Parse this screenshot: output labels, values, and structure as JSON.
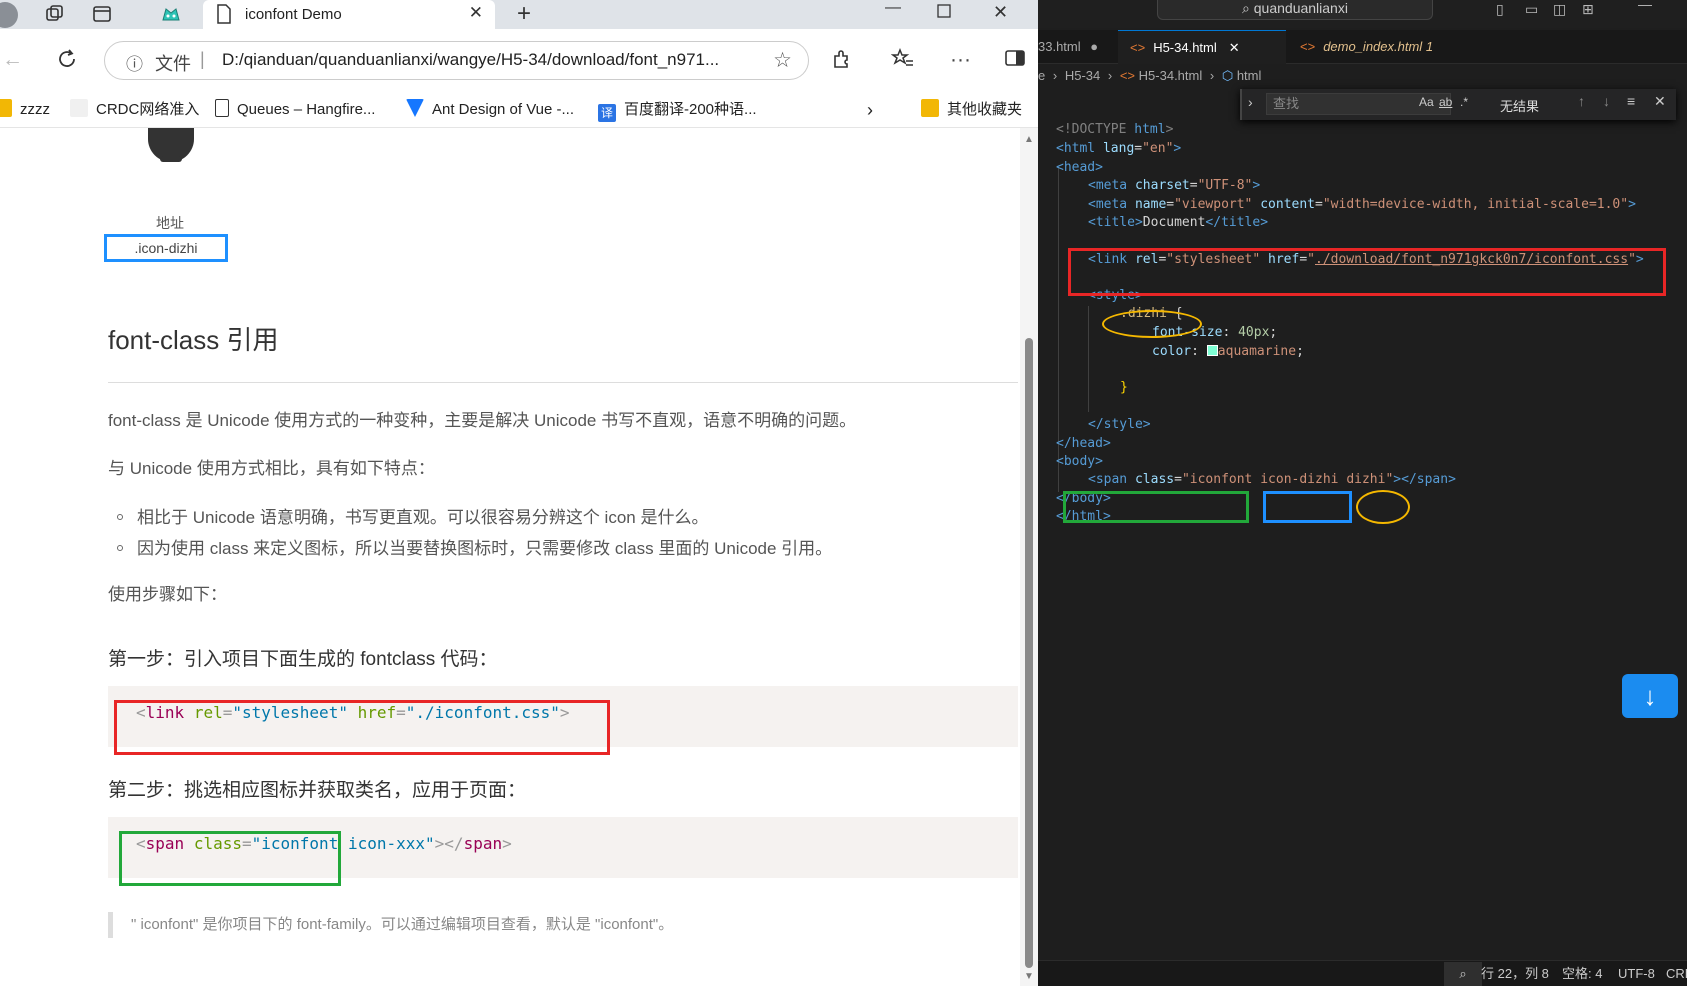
{
  "browser": {
    "tab_title": "iconfont Demo",
    "address": {
      "scheme_label": "文件",
      "url": "D:/qianduan/quanduanlianxi/wangye/H5-34/download/font_n971..."
    },
    "bookmarks": [
      {
        "label": "zzzz",
        "color": "#f2b705"
      },
      {
        "label": "CRDC网络准入",
        "color": "#ffffff"
      },
      {
        "label": "Queues – Hangfire...",
        "color": "#ffffff"
      },
      {
        "label": "Ant Design of Vue -...",
        "color": "#1677ff"
      },
      {
        "label": "百度翻译-200种语...",
        "color": "#2b74e4"
      },
      {
        "label": "其他收藏夹",
        "color": "#f2b705"
      }
    ]
  },
  "page": {
    "icon_name": "地址",
    "icon_class": ".icon-dizhi",
    "heading": "font-class 引用",
    "para1": "font-class 是 Unicode 使用方式的一种变种，主要是解决 Unicode 书写不直观，语意不明确的问题。",
    "para2": "与 Unicode 使用方式相比，具有如下特点：",
    "list": [
      "相比于 Unicode 语意明确，书写更直观。可以很容易分辨这个 icon 是什么。",
      "因为使用 class 来定义图标，所以当要替换图标时，只需要修改 class 里面的 Unicode 引用。"
    ],
    "para3": "使用步骤如下：",
    "step1": "第一步：引入项目下面生成的 fontclass 代码：",
    "code1": {
      "lt": "<",
      "tag": "link",
      "sp1": " ",
      "attr1": "rel",
      "eq1": "=",
      "val1": "\"stylesheet\"",
      "sp2": " ",
      "attr2": "href",
      "eq2": "=",
      "val2": "\"./iconfont.css\"",
      "gt": ">"
    },
    "step2": "第二步：挑选相应图标并获取类名，应用于页面：",
    "code2": {
      "lt": "<",
      "tag": "span",
      "sp1": " ",
      "attr1": "class",
      "eq1": "=",
      "val1": "\"iconfont icon-xxx\"",
      "gt": ">",
      "close": "</",
      "tag2": "span",
      "gt2": ">"
    },
    "note": "\" iconfont\" 是你项目下的 font-family。可以通过编辑项目查看，默认是 \"iconfont\"。"
  },
  "vscode": {
    "title_search": "quanduanlianxi",
    "tabs": [
      {
        "label": "33.html",
        "marker": "●"
      },
      {
        "label": "H5-34.html",
        "marker": "✕"
      },
      {
        "label": "demo_index.html",
        "marker": "1"
      }
    ],
    "breadcrumb": {
      "c1": "H5-34",
      "c2": "H5-34.html",
      "c3": "html"
    },
    "find": {
      "placeholder": "查找",
      "opt1": "Aa",
      "opt2": "ab",
      "opt3": ".*",
      "result": "无结果"
    },
    "code": {
      "l1a": "<!DOCTYPE",
      "l1b": "html",
      "l1c": ">",
      "l2a": "<html",
      "l2b": "lang",
      "l2c": "=",
      "l2d": "\"en\"",
      "l2e": ">",
      "l3a": "<head>",
      "l4a": "<meta",
      "l4b": "charset",
      "l4c": "=",
      "l4d": "\"UTF-8\"",
      "l4e": ">",
      "l5a": "<meta",
      "l5b": "name",
      "l5c": "=",
      "l5d": "\"viewport\"",
      "l5e": "content",
      "l5f": "=",
      "l5g": "\"width=device-width, initial-scale=1.0\"",
      "l5h": ">",
      "l6a": "<title>",
      "l6b": "Document",
      "l6c": "</title>",
      "l8a": "<link",
      "l8b": "rel",
      "l8c": "=",
      "l8d": "\"stylesheet\"",
      "l8e": "href",
      "l8f": "=",
      "l8g1": "\"",
      "l8g2": "./download/font_n971gkck0n7/iconfont.css",
      "l8g3": "\"",
      "l8h": ">",
      "l10a": "<style>",
      "l11a": ".dizhi",
      "l11b": "{",
      "l12a": "font-size",
      "l12b": ":",
      "l12c": "40px",
      "l12d": ";",
      "l13a": "color",
      "l13b": ":",
      "l13c": "aquamarine",
      "l13d": ";",
      "l15a": "}",
      "l17a": "</style>",
      "l18a": "</head>",
      "l19a": "<body>",
      "l20a": "<span",
      "l20b": "class",
      "l20c": "=",
      "l20d1": "\"iconfont",
      "l20d2": "icon-dizhi",
      "l20d3": "dizhi\"",
      "l20e": "></span>",
      "l21a": "</body>",
      "l22a": "</html>"
    },
    "swatch_color": "#7fffd4",
    "status": {
      "pos": "行 22，列 8",
      "spaces": "空格: 4",
      "enc": "UTF-8",
      "eol": "CRL"
    }
  }
}
